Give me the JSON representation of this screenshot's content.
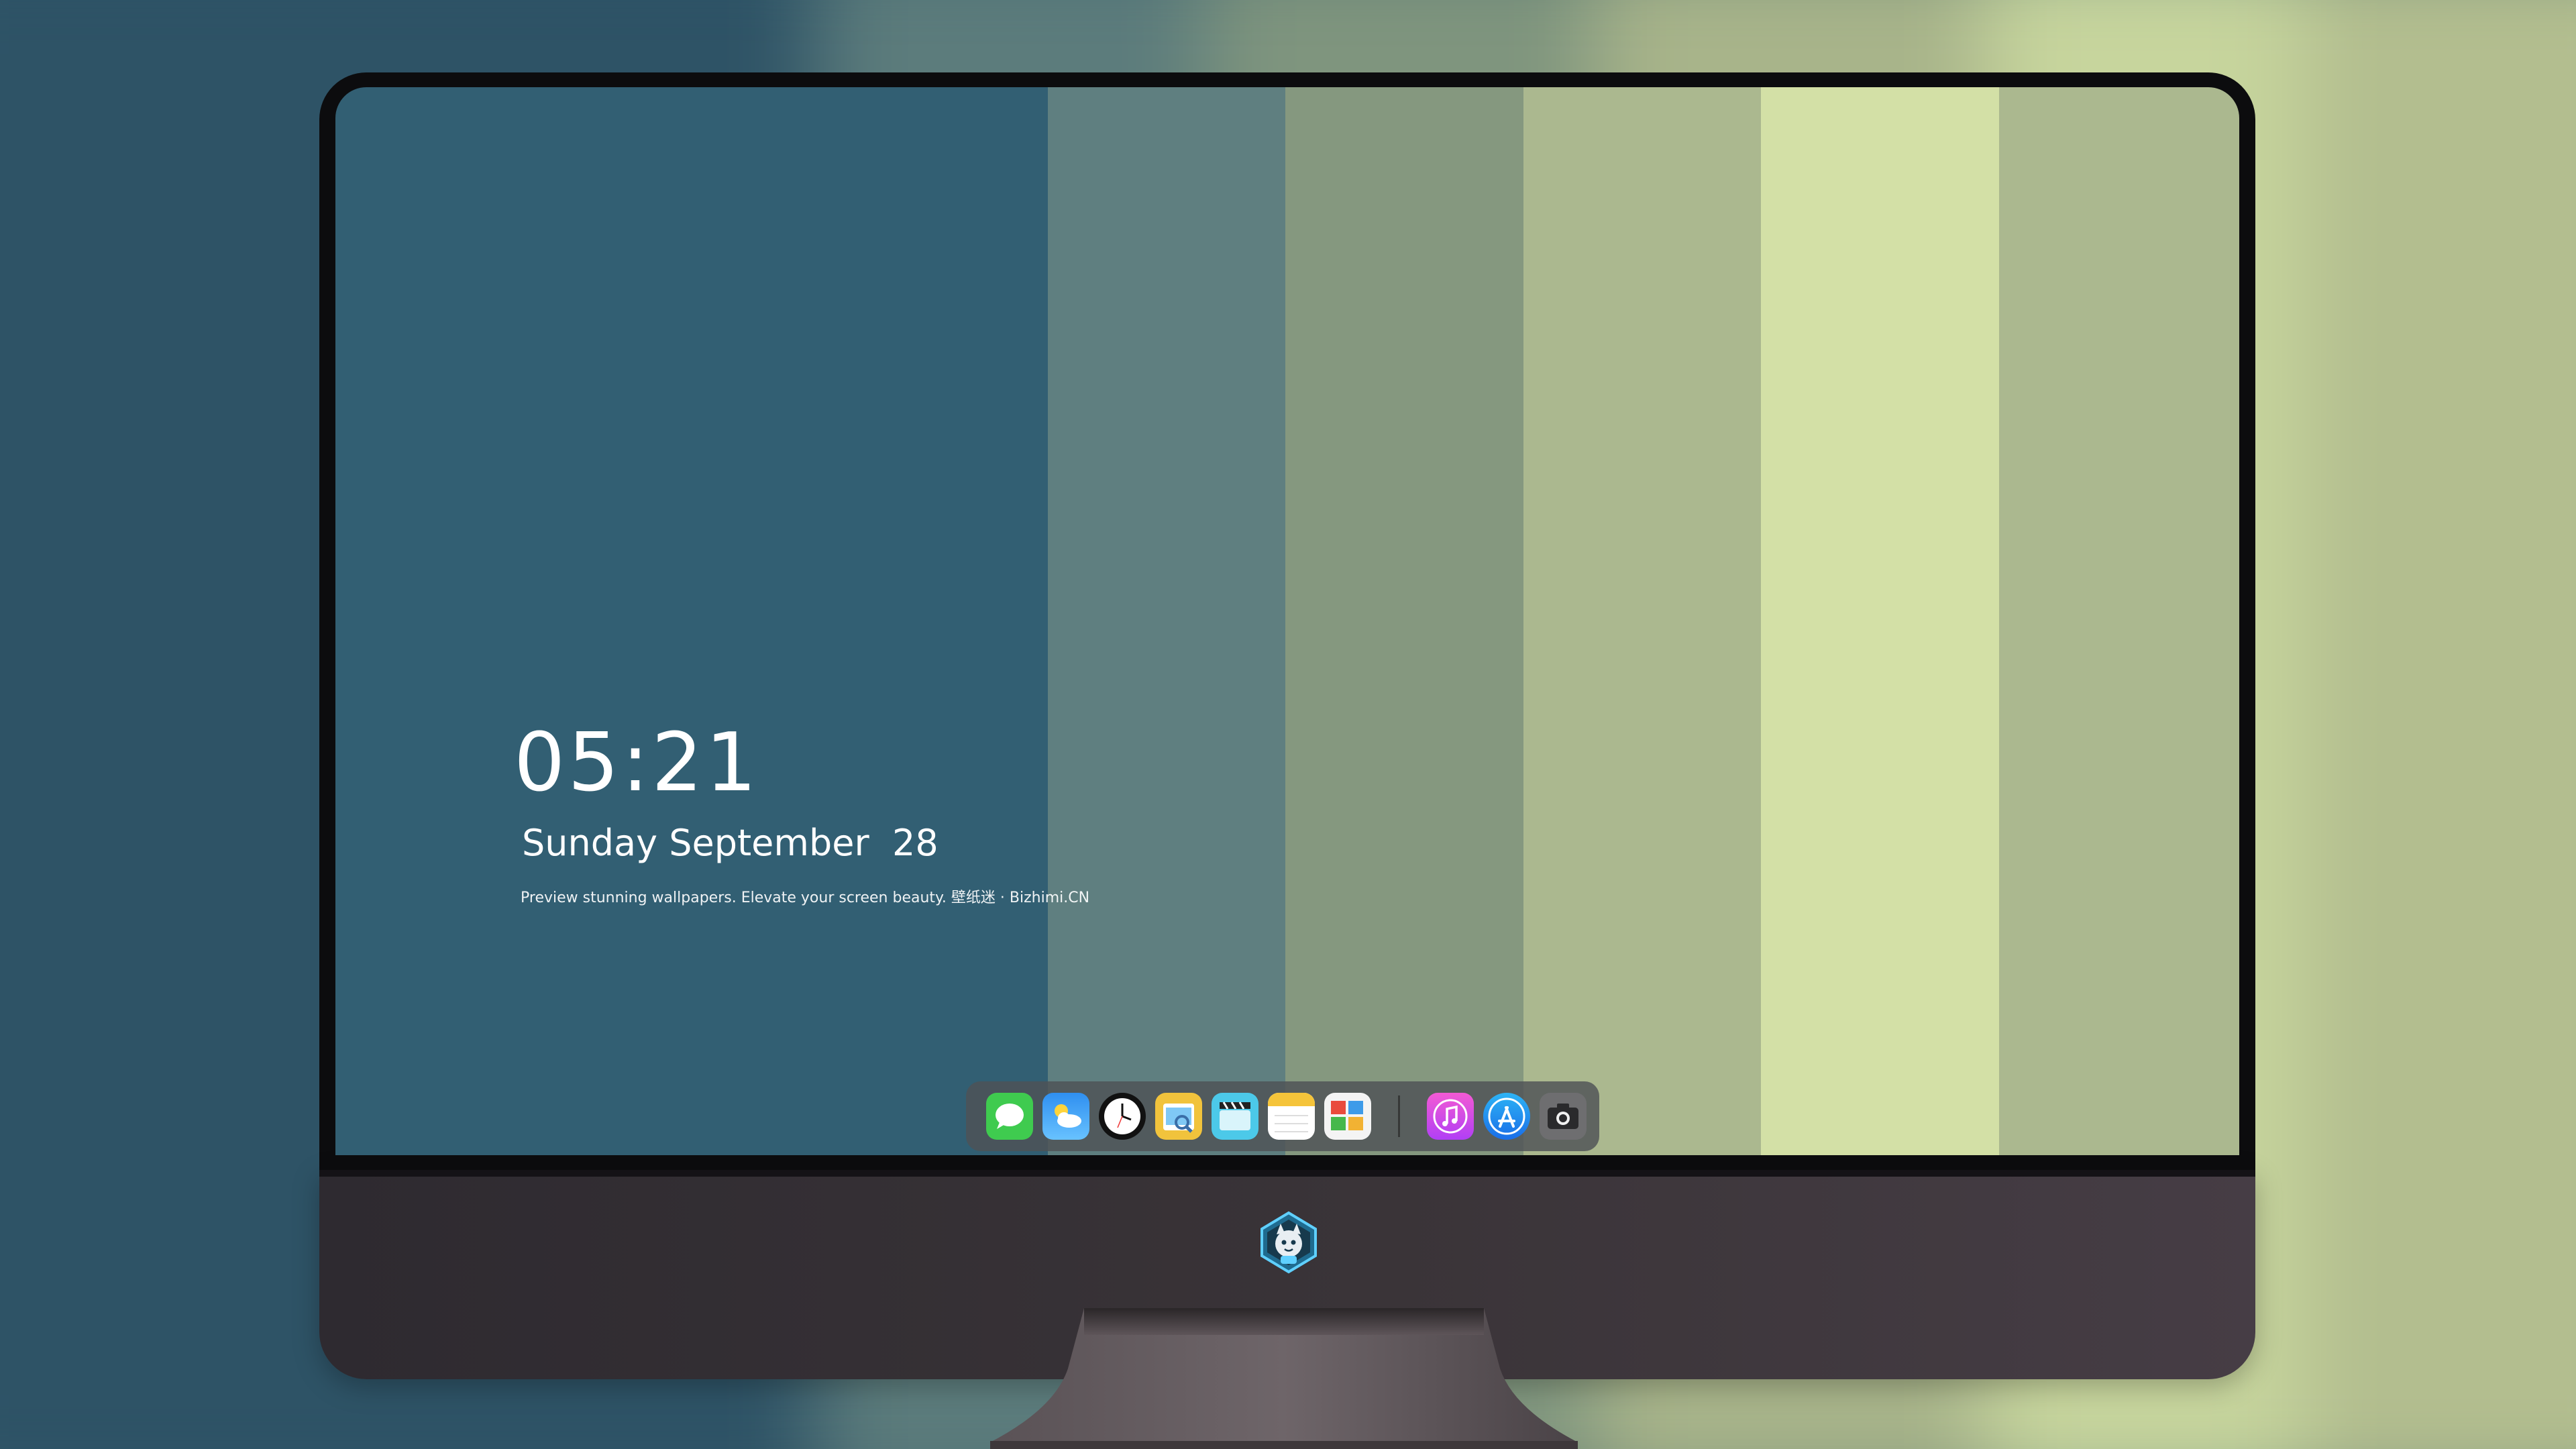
{
  "palette": {
    "stripes": [
      "#325f73",
      "#5f7f80",
      "#85987f",
      "#abb88f",
      "#d3e0a6",
      "#abb88f"
    ],
    "backdrop": [
      "#2e5366",
      "#2e5366",
      "#5c7c7c",
      "#7f957e",
      "#a8b48a",
      "#c7d59d",
      "#b3be8f"
    ],
    "bezel": "#0c0c0e",
    "chin": "#3a3438"
  },
  "clock": {
    "time": "05:21",
    "date": "Sunday September  28",
    "caption": "Preview stunning wallpapers. Elevate your screen beauty. 壁纸迷 · Bizhimi.CN"
  },
  "dock": {
    "apps": [
      {
        "name": "messages-icon"
      },
      {
        "name": "weather-icon"
      },
      {
        "name": "clock-icon"
      },
      {
        "name": "preview-icon"
      },
      {
        "name": "clips-icon"
      },
      {
        "name": "notes-icon"
      },
      {
        "name": "photo-booth-icon"
      }
    ],
    "apps_right": [
      {
        "name": "music-icon"
      },
      {
        "name": "app-store-icon"
      },
      {
        "name": "camera-icon"
      }
    ]
  },
  "chin_logo": "mascot-logo-icon"
}
